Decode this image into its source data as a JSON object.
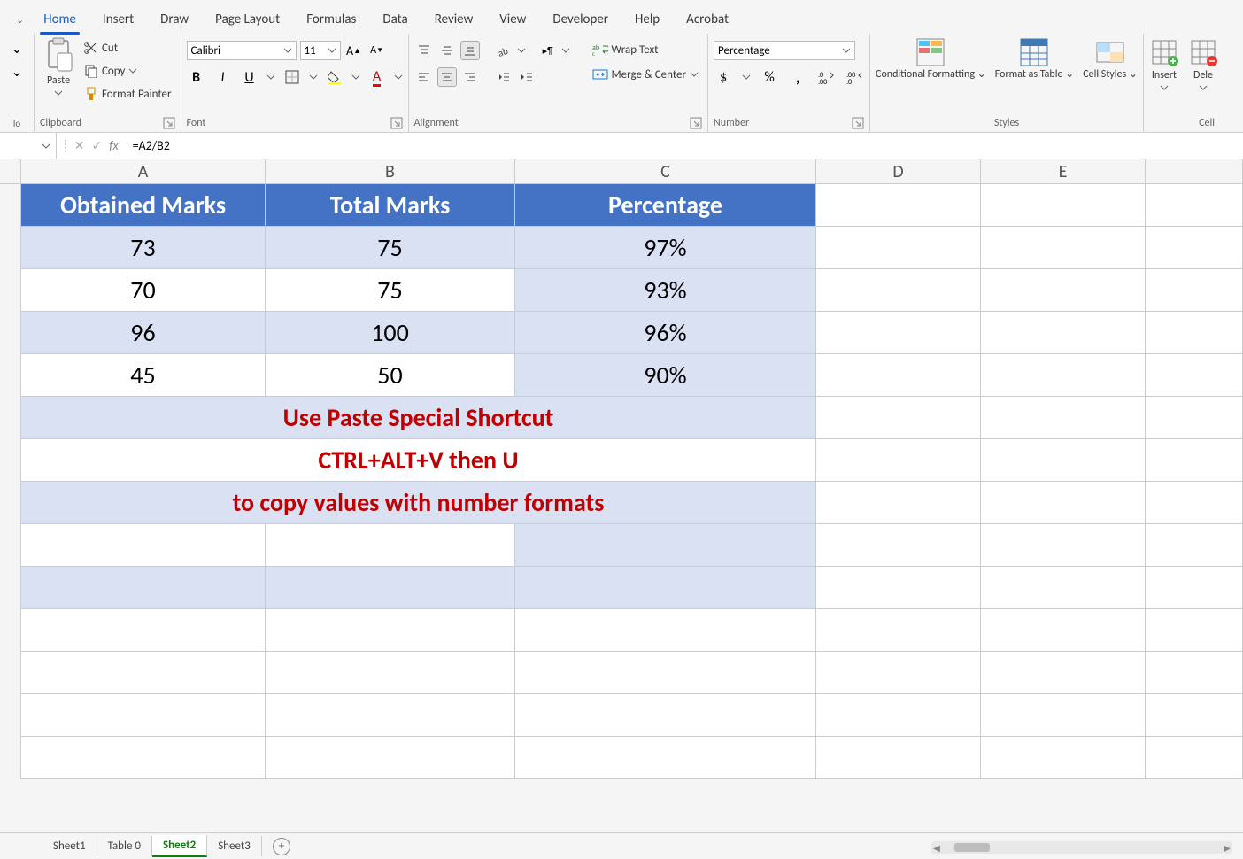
{
  "tabs": [
    "Home",
    "Insert",
    "Draw",
    "Page Layout",
    "Formulas",
    "Data",
    "Review",
    "View",
    "Developer",
    "Help",
    "Acrobat"
  ],
  "activeTab": "Home",
  "ribbon": {
    "clipboard": {
      "paste": "Paste",
      "cut": "Cut",
      "copy": "Copy",
      "fmtpainter": "Format Painter",
      "label": "Clipboard"
    },
    "font": {
      "name": "Calibri",
      "size": "11",
      "label": "Font"
    },
    "alignment": {
      "wrap": "Wrap Text",
      "merge": "Merge & Center",
      "label": "Alignment"
    },
    "number": {
      "format": "Percentage",
      "label": "Number"
    },
    "styles": {
      "cond": "Conditional Formatting",
      "fat": "Format as Table",
      "cstyle": "Cell Styles",
      "label": "Styles"
    },
    "cells": {
      "insert": "Insert",
      "delete": "Dele",
      "label": "Cell"
    }
  },
  "formulaBar": {
    "fx": "fx",
    "formula": "=A2/B2"
  },
  "columns": [
    "A",
    "B",
    "C",
    "D",
    "E"
  ],
  "headers": {
    "a": "Obtained Marks",
    "b": "Total Marks",
    "c": "Percentage"
  },
  "rows": [
    {
      "a": "73",
      "b": "75",
      "c": "97%"
    },
    {
      "a": "70",
      "b": "75",
      "c": "93%"
    },
    {
      "a": "96",
      "b": "100",
      "c": "96%"
    },
    {
      "a": "45",
      "b": "50",
      "c": "90%"
    }
  ],
  "notes": [
    "Use Paste Special Shortcut",
    "CTRL+ALT+V then U",
    "to copy values with number formats"
  ],
  "sheetTabs": [
    "Sheet1",
    "Table 0",
    "Sheet2",
    "Sheet3"
  ],
  "activeSheet": "Sheet2"
}
